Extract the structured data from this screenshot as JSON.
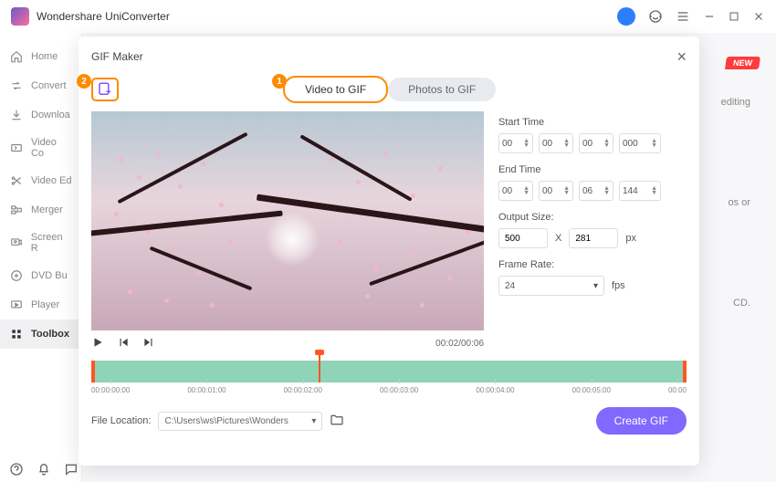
{
  "app": {
    "title": "Wondershare UniConverter"
  },
  "sidebar": {
    "items": [
      {
        "label": "Home"
      },
      {
        "label": "Convert"
      },
      {
        "label": "Downloa"
      },
      {
        "label": "Video Co"
      },
      {
        "label": "Video Ed"
      },
      {
        "label": "Merger"
      },
      {
        "label": "Screen R"
      },
      {
        "label": "DVD Bu"
      },
      {
        "label": "Player"
      },
      {
        "label": "Toolbox"
      }
    ]
  },
  "badge": {
    "new": "NEW"
  },
  "bg": {
    "text1": "editing",
    "text2": "os or",
    "text3": "CD."
  },
  "modal": {
    "title": "GIF Maker",
    "callout1": "1",
    "callout2": "2",
    "tabs": {
      "video": "Video to GIF",
      "photo": "Photos to GIF"
    },
    "play": {
      "time": "00:02/00:06"
    },
    "timeline": {
      "ticks": [
        "00:00:00:00",
        "00:00:01:00",
        "00:00:02:00",
        "00:00:03:00",
        "00:00:04:00",
        "00:00:05:00",
        "00:00"
      ]
    },
    "settings": {
      "start_label": "Start Time",
      "start": {
        "h": "00",
        "m": "00",
        "s": "00",
        "ms": "000"
      },
      "end_label": "End Time",
      "end": {
        "h": "00",
        "m": "00",
        "s": "06",
        "ms": "144"
      },
      "size_label": "Output Size:",
      "size_w": "500",
      "size_x": "X",
      "size_h": "281",
      "size_unit": "px",
      "rate_label": "Frame Rate:",
      "rate": "24",
      "rate_unit": "fps"
    },
    "file": {
      "label": "File Location:",
      "path": "C:\\Users\\ws\\Pictures\\Wonders"
    },
    "create": "Create GIF"
  }
}
